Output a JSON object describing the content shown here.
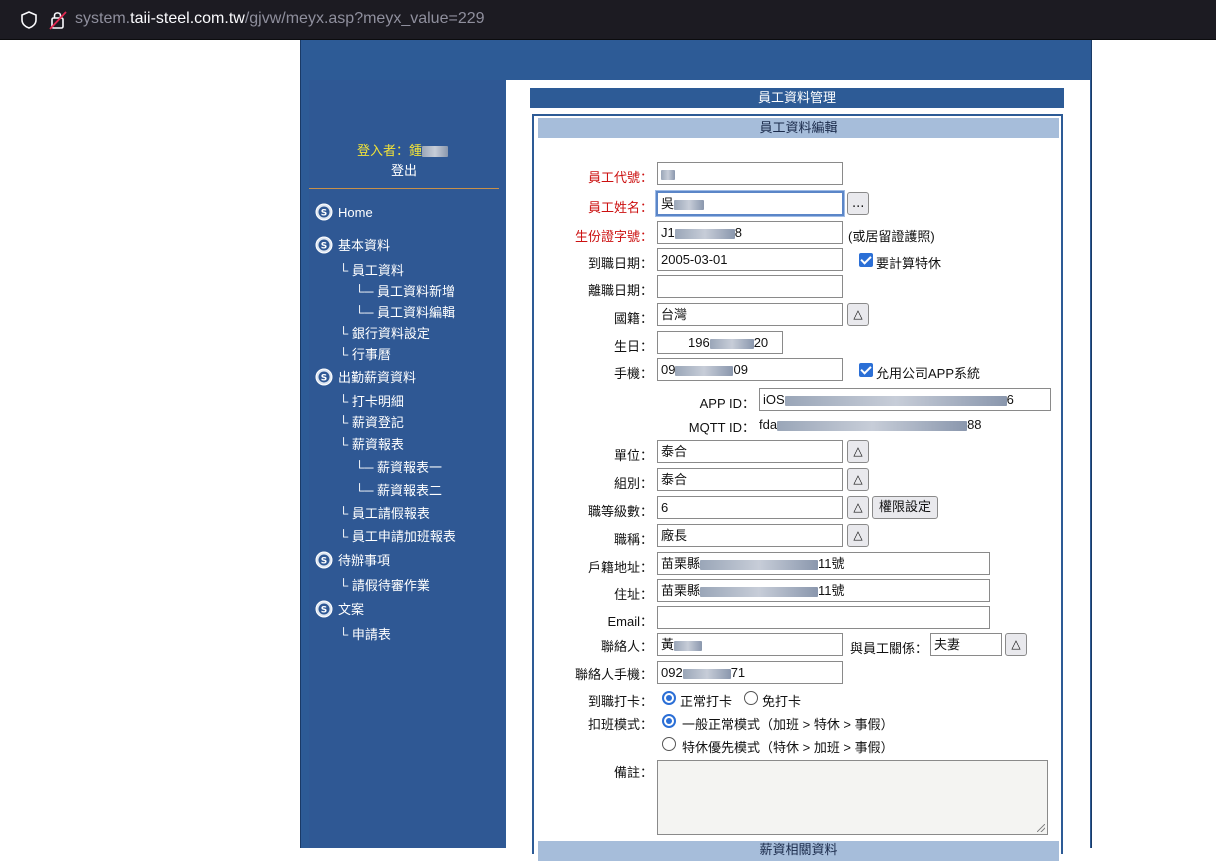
{
  "browser": {
    "url_prefix": "system.",
    "url_domain": "taii-steel.com.tw",
    "url_path": "/gjvw/meyx.asp?meyx_value=229"
  },
  "sidebar": {
    "login_label": "登入者：鍾",
    "logout_label": "登出",
    "menu": [
      {
        "label": "Home"
      },
      {
        "label": "基本資料"
      },
      {
        "label": "└ 員工資料"
      },
      {
        "label": "└─ 員工資料新增"
      },
      {
        "label": "└─ 員工資料編輯"
      },
      {
        "label": "└ 銀行資料設定"
      },
      {
        "label": "└ 行事曆"
      },
      {
        "label": "出勤薪資資料"
      },
      {
        "label": "└ 打卡明細"
      },
      {
        "label": "└ 薪資登記"
      },
      {
        "label": "└ 薪資報表"
      },
      {
        "label": "└─ 薪資報表一"
      },
      {
        "label": "└─ 薪資報表二"
      },
      {
        "label": "└ 員工請假報表"
      },
      {
        "label": "└ 員工申請加班報表"
      },
      {
        "label": "待辦事項"
      },
      {
        "label": "└ 請假待審作業"
      },
      {
        "label": "文案"
      },
      {
        "label": "└ 申請表"
      }
    ]
  },
  "main": {
    "title": "員工資料管理",
    "subtitle": "員工資料編輯",
    "next_section": "薪資相關資料"
  },
  "form": {
    "emp_id_label": "員工代號：",
    "emp_id_value": "",
    "emp_name_label": "員工姓名：",
    "emp_name_value": "吳",
    "emp_name_button": "...",
    "id_no_label": "生份證字號：",
    "id_no_value_start": "J1",
    "id_no_value_end": "8",
    "id_no_note": "(或居留證護照)",
    "hire_date_label": "到職日期：",
    "hire_date_value": "2005-03-01",
    "special_leave_label": "要計算特休",
    "leave_date_label": "離職日期：",
    "leave_date_value": "",
    "nationality_label": "國籍：",
    "nationality_value": "台灣",
    "birthday_label": "生日：",
    "birthday_start": "196",
    "birthday_end": "20",
    "mobile_label": "手機：",
    "mobile_start": "09",
    "mobile_end": "09",
    "app_label": "允用公司APP系統",
    "app_id_label": "APP ID：",
    "app_id_start": "iOS",
    "app_id_end": "6",
    "mqtt_label": "MQTT ID：",
    "mqtt_start": "fda",
    "mqtt_end": "88",
    "unit_label": "單位：",
    "unit_value": "泰合",
    "group_label": "組別：",
    "group_value": "泰合",
    "grade_label": "職等級數：",
    "grade_value": "6",
    "permission_button": "權限設定",
    "title_label": "職稱：",
    "title_value": "廠長",
    "reg_addr_label": "戶籍地址：",
    "reg_addr_start": "苗栗縣",
    "reg_addr_end": "11號",
    "addr_label": "住址：",
    "addr_start": "苗栗縣",
    "addr_end": "11號",
    "email_label": "Email：",
    "email_value": "",
    "contact_label": "聯絡人：",
    "contact_value": "黃",
    "relation_label": "與員工關係：",
    "relation_value": "夫妻",
    "contact_mobile_label": "聯絡人手機：",
    "contact_mobile_start": "092",
    "contact_mobile_end": "71",
    "clock_label": "到職打卡：",
    "clock_opt1": "正常打卡",
    "clock_opt2": "免打卡",
    "deduct_label": "扣班模式：",
    "deduct_opt1": "一般正常模式（加班 > 特休 > 事假）",
    "deduct_opt2": "特休優先模式（特休 > 加班 > 事假）",
    "remark_label": "備註：",
    "triangle": "△"
  }
}
